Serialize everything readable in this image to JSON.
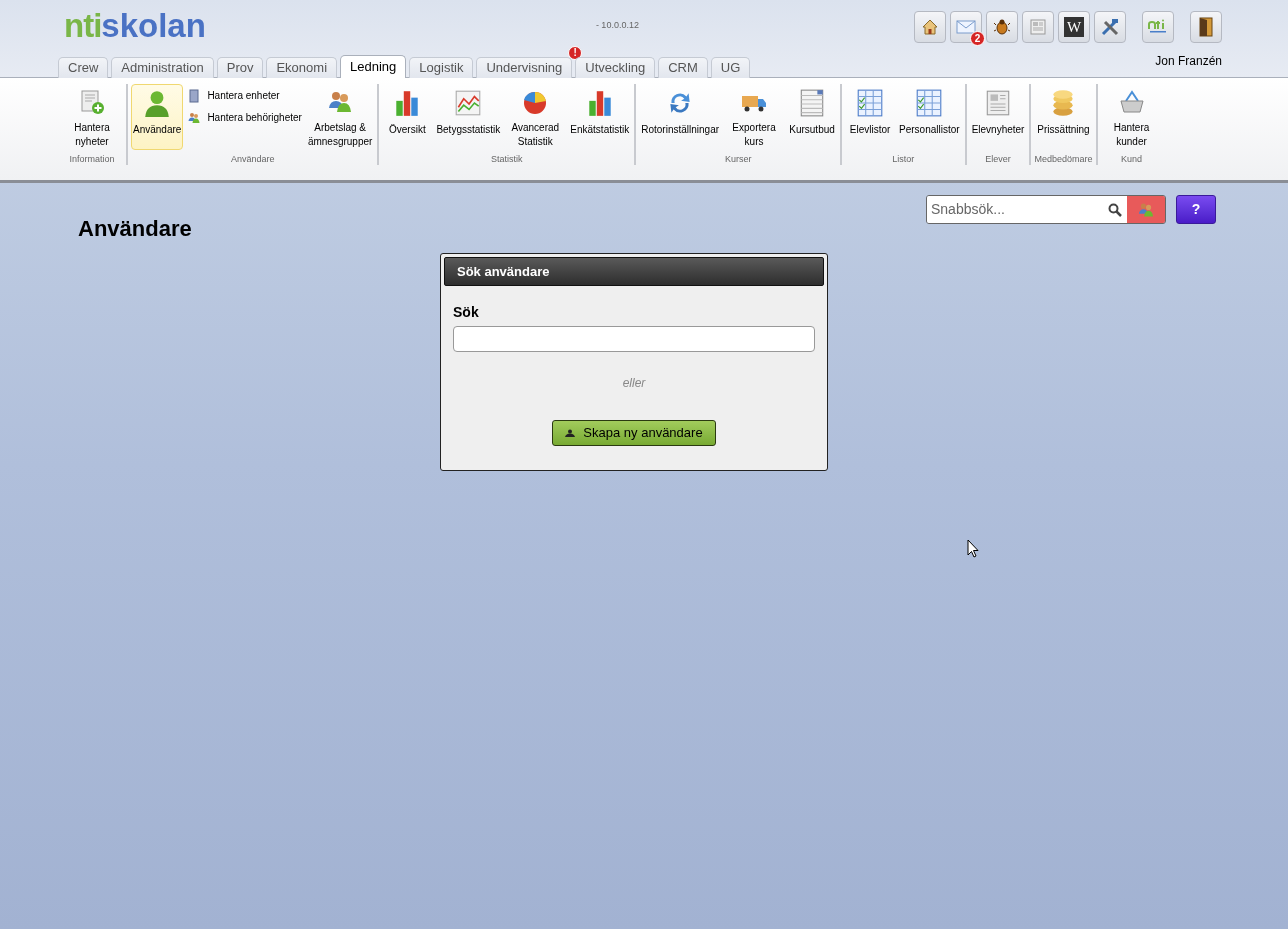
{
  "logo": {
    "part_1": "nti",
    "part_2": "skolan"
  },
  "version": "- 10.0.0.12",
  "header_icons": [
    {
      "kind": "home"
    },
    {
      "kind": "mail",
      "badge": "2"
    },
    {
      "kind": "bug"
    },
    {
      "kind": "news"
    },
    {
      "kind": "wiki",
      "label": "W"
    },
    {
      "kind": "tools"
    },
    {
      "kind": "nti"
    },
    {
      "kind": "door"
    }
  ],
  "user_name": "Jon Franzén",
  "tabs": [
    {
      "label": "Crew",
      "selected": false
    },
    {
      "label": "Administration",
      "selected": false
    },
    {
      "label": "Prov",
      "selected": false
    },
    {
      "label": "Ekonomi",
      "selected": false
    },
    {
      "label": "Ledning",
      "selected": true
    },
    {
      "label": "Logistik",
      "selected": false
    },
    {
      "label": "Undervisning",
      "selected": false,
      "badge": "!"
    },
    {
      "label": "Utveckling",
      "selected": false
    },
    {
      "label": "CRM",
      "selected": false
    },
    {
      "label": "UG",
      "selected": false
    }
  ],
  "ribbon_groups": [
    {
      "label": "Information",
      "items": [
        {
          "kind": "large",
          "label": "Hantera nyheter",
          "selected": false
        }
      ]
    },
    {
      "label": "Användare",
      "items": [
        {
          "kind": "large",
          "label": "Användare",
          "selected": true
        },
        {
          "kind": "small",
          "label": "Hantera enheter",
          "selected": false
        },
        {
          "kind": "small",
          "label": "Hantera behörigheter",
          "selected": false
        },
        {
          "kind": "large",
          "label": "Arbetslag & ämnesgrupper",
          "selected": false
        }
      ]
    },
    {
      "label": "Statistik",
      "items": [
        {
          "kind": "large",
          "label": "Översikt",
          "selected": false
        },
        {
          "kind": "large",
          "label": "Betygsstatistik",
          "selected": false
        },
        {
          "kind": "large",
          "label": "Avancerad Statistik",
          "selected": false
        },
        {
          "kind": "large",
          "label": "Enkätstatistik",
          "selected": false
        }
      ]
    },
    {
      "label": "Kurser",
      "items": [
        {
          "kind": "large",
          "label": "Rotorinställningar",
          "selected": false
        },
        {
          "kind": "large",
          "label": "Exportera kurs",
          "selected": false
        },
        {
          "kind": "large",
          "label": "Kursutbud",
          "selected": false
        }
      ]
    },
    {
      "label": "Listor",
      "items": [
        {
          "kind": "large",
          "label": "Elevlistor",
          "selected": false
        },
        {
          "kind": "large",
          "label": "Personallistor",
          "selected": false
        }
      ]
    },
    {
      "label": "Elever",
      "items": [
        {
          "kind": "large",
          "label": "Elevnyheter",
          "selected": false
        }
      ]
    },
    {
      "label": "Medbedömare",
      "items": [
        {
          "kind": "large",
          "label": "Prissättning",
          "selected": false
        }
      ]
    },
    {
      "label": "Kund",
      "items": [
        {
          "kind": "large",
          "label": "Hantera kunder",
          "selected": false
        }
      ]
    }
  ],
  "quick_search": {
    "placeholder": "Snabbsök..."
  },
  "help_button": "?",
  "page_title": "Användare",
  "search_panel": {
    "title": "Sök användare",
    "field_label": "Sök",
    "or_text": "eller",
    "create_button": "Skapa ny användare"
  }
}
